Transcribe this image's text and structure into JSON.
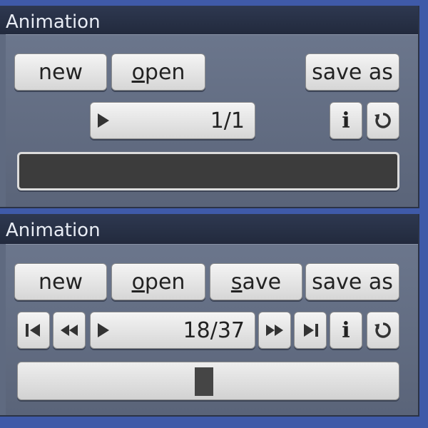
{
  "panel1": {
    "title": "Animation",
    "buttons": {
      "new": "new",
      "open": "open",
      "save_as": "save as"
    },
    "frame_counter": "1/1",
    "progress_fraction": 0
  },
  "panel2": {
    "title": "Animation",
    "buttons": {
      "new": "new",
      "open": "open",
      "save": "save",
      "save_as": "save as"
    },
    "frame_counter": "18/37",
    "progress_fraction": 0.486
  },
  "icons": {
    "play": "play-icon",
    "info": "info-icon",
    "loop": "loop-icon",
    "first": "skip-to-start-icon",
    "rewind": "rewind-icon",
    "forward": "fast-forward-icon",
    "last": "skip-to-end-icon"
  },
  "colors": {
    "panel_bg": "#5f6a80",
    "titlebar": "#252e42",
    "button": "#e6e6e6",
    "track_dark": "#3c3c3c",
    "desktop": "#3f5aa8"
  }
}
